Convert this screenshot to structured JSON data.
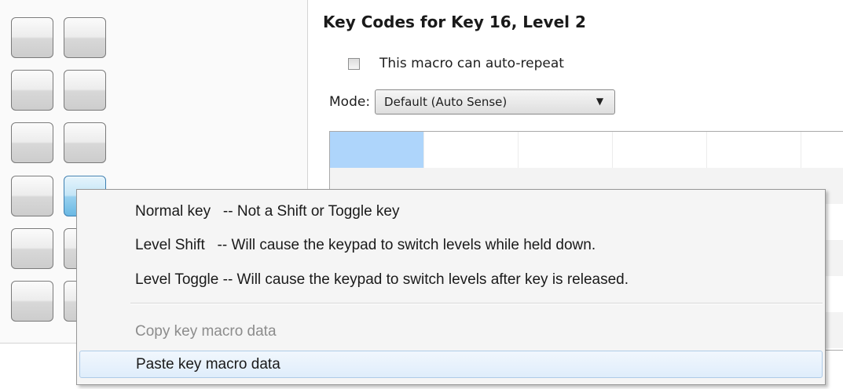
{
  "section": {
    "title": "Key Codes for Key 16, Level 2"
  },
  "auto_repeat": {
    "label": "This macro can auto-repeat",
    "checked": false
  },
  "mode": {
    "label": "Mode:",
    "selected": "Default (Auto Sense)"
  },
  "keypad": {
    "rows": 6,
    "cols": 2,
    "selected_key": {
      "row": 4,
      "col": 2
    }
  },
  "context_menu": {
    "items": [
      {
        "label": "Normal key   -- Not a Shift or Toggle key",
        "enabled": true
      },
      {
        "label": "Level Shift   -- Will cause the keypad to switch levels while held down.",
        "enabled": true
      },
      {
        "label": "Level Toggle -- Will cause the keypad to switch levels after key is released.",
        "enabled": true
      },
      {
        "label": "Copy key macro data",
        "enabled": false
      },
      {
        "label": "Paste key macro data",
        "enabled": true,
        "highlighted": true
      }
    ]
  },
  "colors": {
    "selection": "#aed5fb",
    "menu_background": "#f5f5f5",
    "selected_key": "#98d1ef"
  }
}
